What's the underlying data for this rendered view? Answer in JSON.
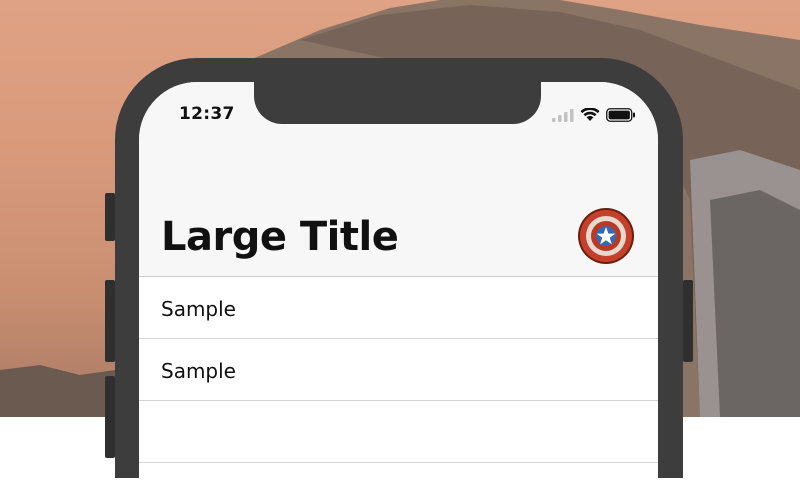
{
  "status_bar": {
    "time": "12:37"
  },
  "navigation": {
    "large_title": "Large Title"
  },
  "list": {
    "items": [
      "Sample",
      "Sample",
      ""
    ]
  }
}
